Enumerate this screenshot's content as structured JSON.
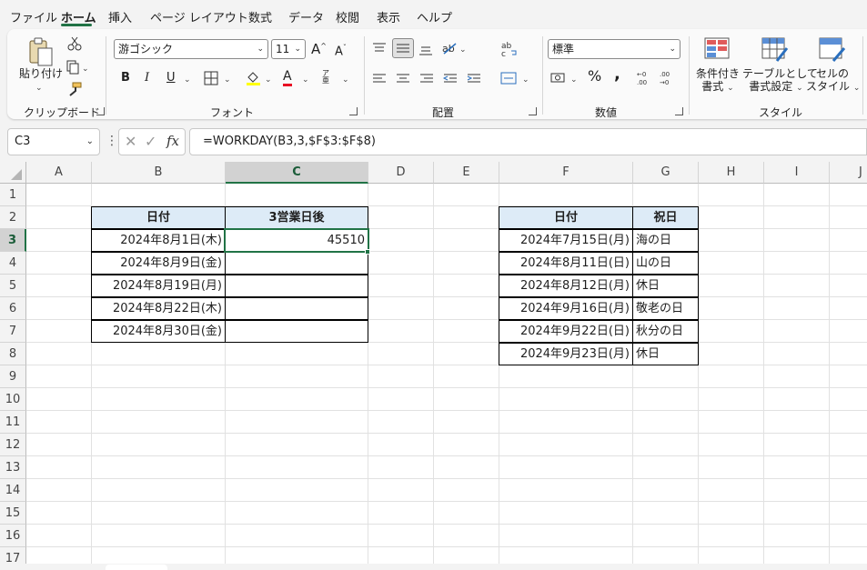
{
  "menu": {
    "items": [
      "ファイル",
      "ホーム",
      "挿入",
      "ページ レイアウト",
      "数式",
      "データ",
      "校閲",
      "表示",
      "ヘルプ"
    ],
    "active": "ホーム"
  },
  "ribbon": {
    "clipboard": {
      "paste": "貼り付け",
      "label": "クリップボード"
    },
    "font": {
      "name": "游ゴシック",
      "size": "11",
      "label": "フォント"
    },
    "alignment": {
      "label": "配置"
    },
    "number": {
      "format": "標準",
      "label": "数値"
    },
    "styles": {
      "conditional": [
        "条件付き",
        "書式"
      ],
      "table": [
        "テーブルとして",
        "書式設定"
      ],
      "cell": [
        "セルの",
        "スタイル"
      ],
      "label": "スタイル"
    },
    "colors": {
      "accent": "#217346",
      "font_red": "#e81123",
      "highlight_yellow": "#ffff00"
    }
  },
  "formula_bar": {
    "name_box": "C3",
    "fx": "fx",
    "formula": "=WORKDAY(B3,3,$F$3:$F$8)"
  },
  "sheet": {
    "columns": [
      "A",
      "B",
      "C",
      "D",
      "E",
      "F",
      "G",
      "H",
      "I",
      "J"
    ],
    "rows": [
      "1",
      "2",
      "3",
      "4",
      "5",
      "6",
      "7",
      "8",
      "9",
      "10",
      "11",
      "12",
      "13",
      "14",
      "15",
      "16",
      "17"
    ],
    "table1": {
      "headers": [
        "日付",
        "3営業日後"
      ],
      "rows": [
        [
          "2024年8月1日(木)",
          "45510"
        ],
        [
          "2024年8月9日(金)",
          ""
        ],
        [
          "2024年8月19日(月)",
          ""
        ],
        [
          "2024年8月22日(木)",
          ""
        ],
        [
          "2024年8月30日(金)",
          ""
        ]
      ]
    },
    "table2": {
      "headers": [
        "日付",
        "祝日"
      ],
      "rows": [
        [
          "2024年7月15日(月)",
          "海の日"
        ],
        [
          "2024年8月11日(日)",
          "山の日"
        ],
        [
          "2024年8月12日(月)",
          "休日"
        ],
        [
          "2024年9月16日(月)",
          "敬老の日"
        ],
        [
          "2024年9月22日(日)",
          "秋分の日"
        ],
        [
          "2024年9月23日(月)",
          "休日"
        ]
      ]
    },
    "header_fill": "#ddebf7"
  }
}
